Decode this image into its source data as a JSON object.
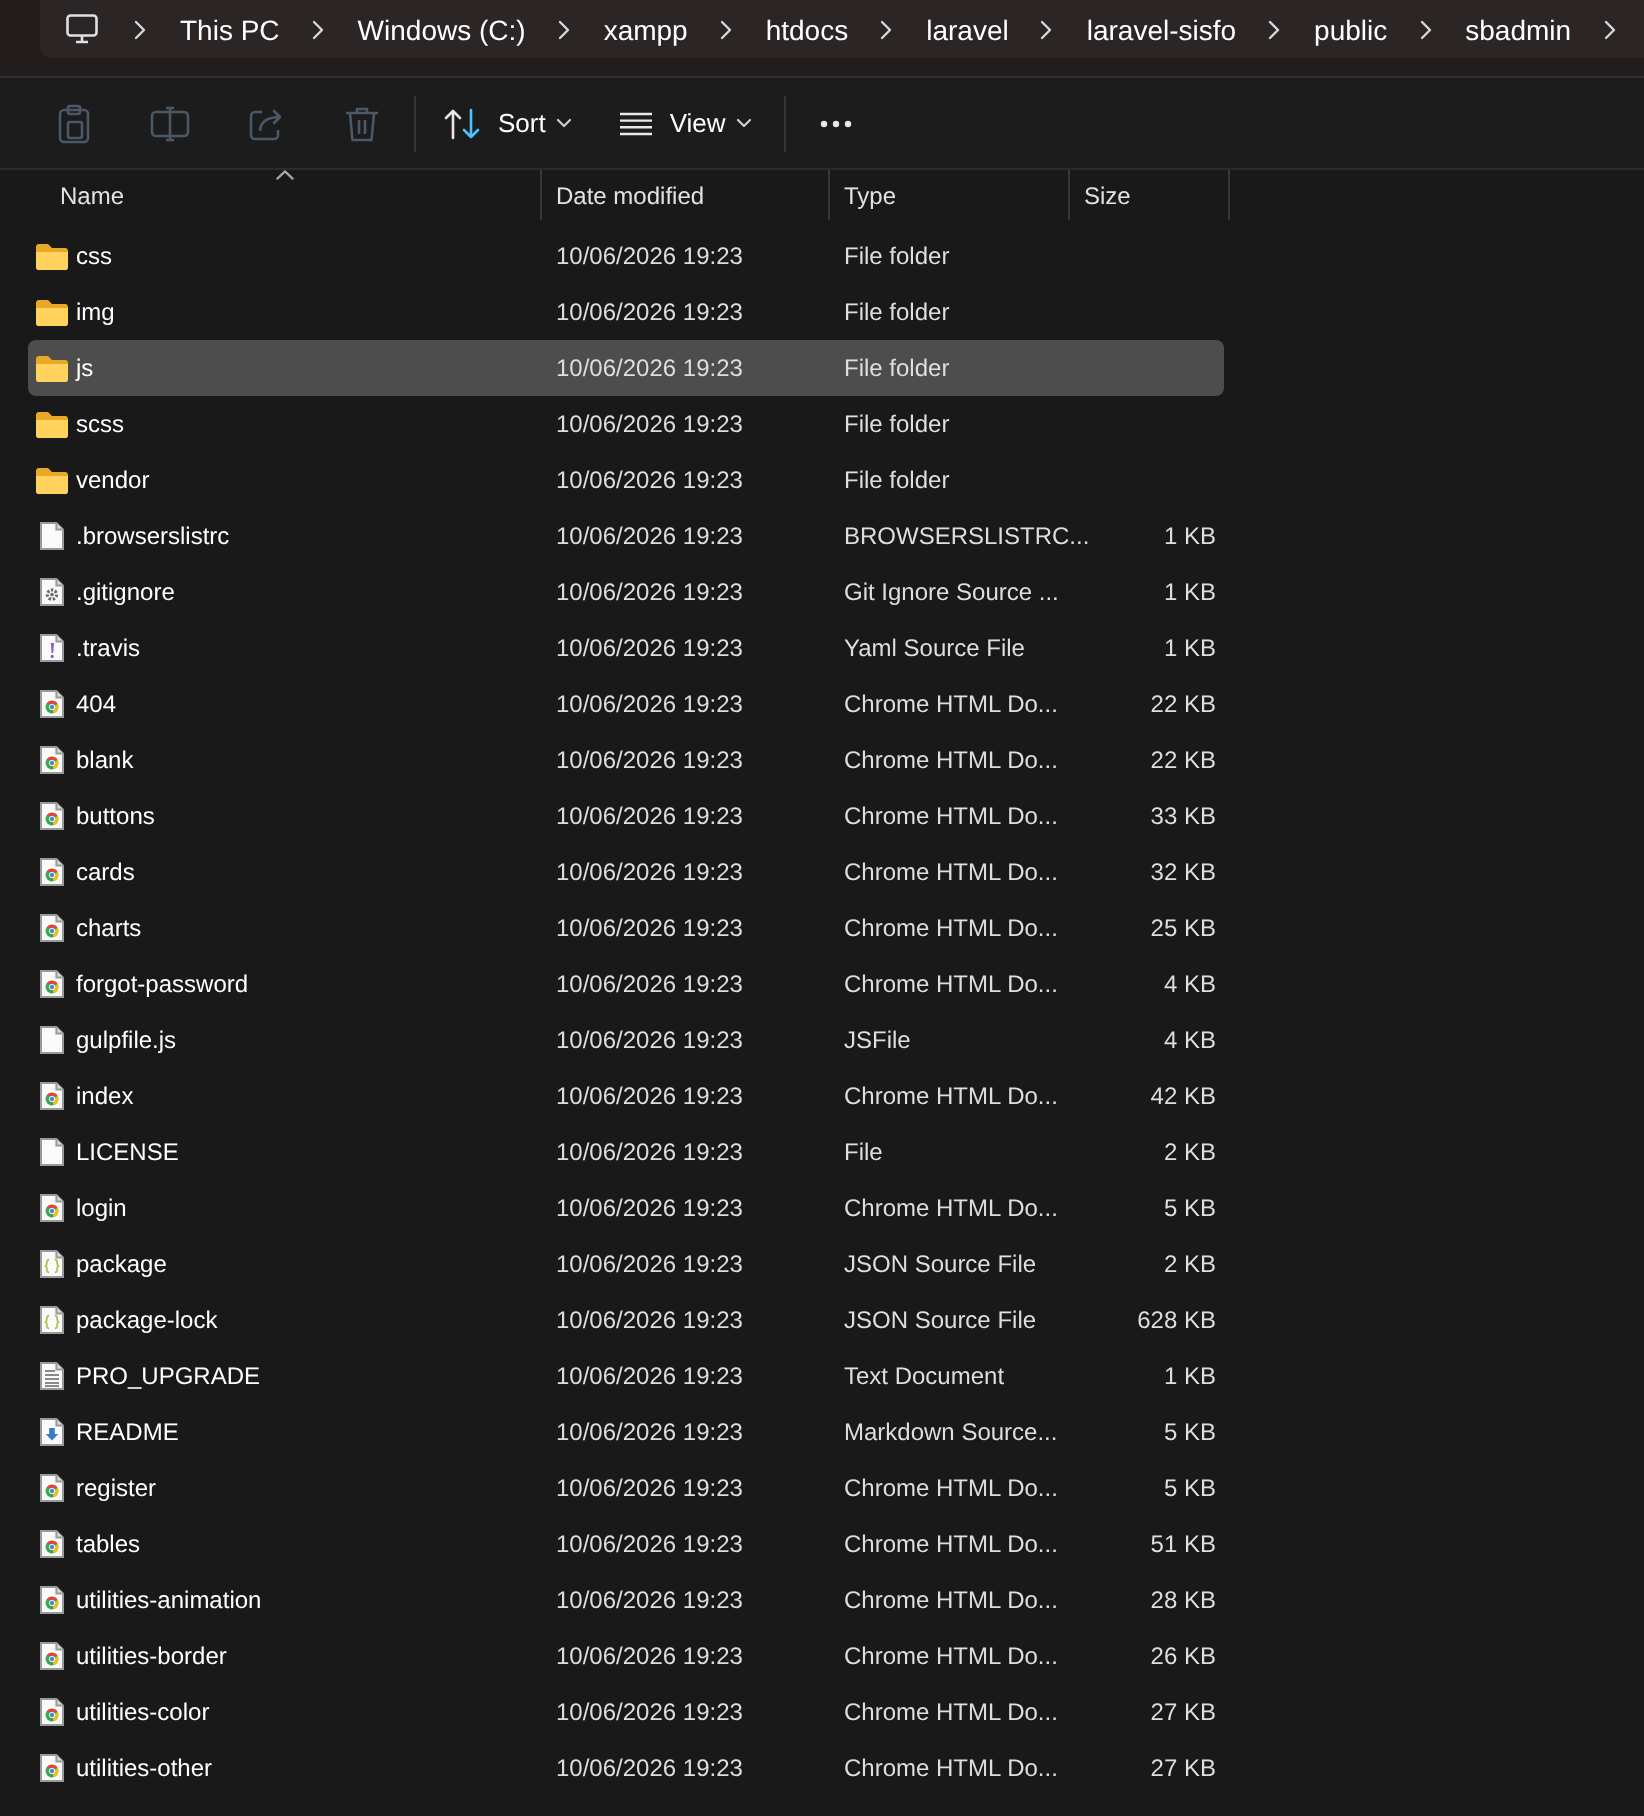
{
  "breadcrumb": {
    "items": [
      "This PC",
      "Windows (C:)",
      "xampp",
      "htdocs",
      "laravel",
      "laravel-sisfo",
      "public",
      "sbadmin"
    ]
  },
  "toolbar": {
    "actions": [
      {
        "kind": "paste",
        "disabled": true
      },
      {
        "kind": "rename",
        "disabled": true
      },
      {
        "kind": "share",
        "disabled": true
      },
      {
        "kind": "delete",
        "disabled": true
      }
    ],
    "menus": [
      {
        "kind": "sort",
        "label": "Sort"
      },
      {
        "kind": "view",
        "label": "View"
      }
    ]
  },
  "columns": [
    {
      "label": "Name",
      "sorted": true
    },
    {
      "label": "Date modified",
      "sorted": false
    },
    {
      "label": "Type",
      "sorted": false
    },
    {
      "label": "Size",
      "sorted": false
    }
  ],
  "rows": [
    {
      "kind": "folder",
      "name": "css",
      "date": "10/06/2026 19:23",
      "type": "File folder",
      "selected": false
    },
    {
      "kind": "folder",
      "name": "img",
      "date": "10/06/2026 19:23",
      "type": "File folder",
      "selected": false
    },
    {
      "kind": "folder",
      "name": "js",
      "date": "10/06/2026 19:23",
      "type": "File folder",
      "selected": true
    },
    {
      "kind": "folder",
      "name": "scss",
      "date": "10/06/2026 19:23",
      "type": "File folder",
      "selected": false
    },
    {
      "kind": "folder",
      "name": "vendor",
      "date": "10/06/2026 19:23",
      "type": "File folder",
      "selected": false
    },
    {
      "kind": "file",
      "name": ".browserslistrc",
      "date": "10/06/2026 19:23",
      "type": "BROWSERSLISTRC...",
      "size": "1 KB",
      "selected": false
    },
    {
      "kind": "config",
      "name": ".gitignore",
      "date": "10/06/2026 19:23",
      "type": "Git Ignore Source ...",
      "size": "1 KB",
      "selected": false
    },
    {
      "kind": "yaml",
      "name": ".travis",
      "date": "10/06/2026 19:23",
      "type": "Yaml Source File",
      "size": "1 KB",
      "selected": false
    },
    {
      "kind": "web",
      "name": "404",
      "date": "10/06/2026 19:23",
      "type": "Chrome HTML Do...",
      "size": "22 KB",
      "selected": false
    },
    {
      "kind": "web",
      "name": "blank",
      "date": "10/06/2026 19:23",
      "type": "Chrome HTML Do...",
      "size": "22 KB",
      "selected": false
    },
    {
      "kind": "web",
      "name": "buttons",
      "date": "10/06/2026 19:23",
      "type": "Chrome HTML Do...",
      "size": "33 KB",
      "selected": false
    },
    {
      "kind": "web",
      "name": "cards",
      "date": "10/06/2026 19:23",
      "type": "Chrome HTML Do...",
      "size": "32 KB",
      "selected": false
    },
    {
      "kind": "web",
      "name": "charts",
      "date": "10/06/2026 19:23",
      "type": "Chrome HTML Do...",
      "size": "25 KB",
      "selected": false
    },
    {
      "kind": "web",
      "name": "forgot-password",
      "date": "10/06/2026 19:23",
      "type": "Chrome HTML Do...",
      "size": "4 KB",
      "selected": false
    },
    {
      "kind": "file",
      "name": "gulpfile.js",
      "date": "10/06/2026 19:23",
      "type": "JSFile",
      "size": "4 KB",
      "selected": false
    },
    {
      "kind": "web",
      "name": "index",
      "date": "10/06/2026 19:23",
      "type": "Chrome HTML Do...",
      "size": "42 KB",
      "selected": false
    },
    {
      "kind": "file",
      "name": "LICENSE",
      "date": "10/06/2026 19:23",
      "type": "File",
      "size": "2 KB",
      "selected": false
    },
    {
      "kind": "web",
      "name": "login",
      "date": "10/06/2026 19:23",
      "type": "Chrome HTML Do...",
      "size": "5 KB",
      "selected": false
    },
    {
      "kind": "json",
      "name": "package",
      "date": "10/06/2026 19:23",
      "type": "JSON Source File",
      "size": "2 KB",
      "selected": false
    },
    {
      "kind": "json",
      "name": "package-lock",
      "date": "10/06/2026 19:23",
      "type": "JSON Source File",
      "size": "628 KB",
      "selected": false
    },
    {
      "kind": "text",
      "name": "PRO_UPGRADE",
      "date": "10/06/2026 19:23",
      "type": "Text Document",
      "size": "1 KB",
      "selected": false
    },
    {
      "kind": "markdown",
      "name": "README",
      "date": "10/06/2026 19:23",
      "type": "Markdown Source...",
      "size": "5 KB",
      "selected": false
    },
    {
      "kind": "web",
      "name": "register",
      "date": "10/06/2026 19:23",
      "type": "Chrome HTML Do...",
      "size": "5 KB",
      "selected": false
    },
    {
      "kind": "web",
      "name": "tables",
      "date": "10/06/2026 19:23",
      "type": "Chrome HTML Do...",
      "size": "51 KB",
      "selected": false
    },
    {
      "kind": "web",
      "name": "utilities-animation",
      "date": "10/06/2026 19:23",
      "type": "Chrome HTML Do...",
      "size": "28 KB",
      "selected": false
    },
    {
      "kind": "web",
      "name": "utilities-border",
      "date": "10/06/2026 19:23",
      "type": "Chrome HTML Do...",
      "size": "26 KB",
      "selected": false
    },
    {
      "kind": "web",
      "name": "utilities-color",
      "date": "10/06/2026 19:23",
      "type": "Chrome HTML Do...",
      "size": "27 KB",
      "selected": false
    },
    {
      "kind": "web",
      "name": "utilities-other",
      "date": "10/06/2026 19:23",
      "type": "Chrome HTML Do...",
      "size": "27 KB",
      "selected": false
    }
  ]
}
